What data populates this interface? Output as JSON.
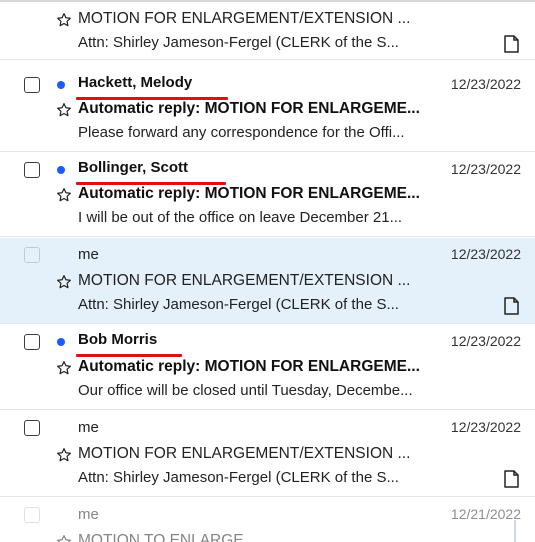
{
  "messages": [
    {
      "sender": "",
      "date": "",
      "unread": false,
      "subject": "MOTION FOR ENLARGEMENT/EXTENSION ...",
      "preview": "Attn: Shirley Jameson-Fergel (CLERK of the S...",
      "attachment": true
    },
    {
      "sender": "Hackett, Melody",
      "date": "12/23/2022",
      "unread": true,
      "subject": "Automatic reply: MOTION FOR ENLARGEME...",
      "preview": "Please forward any correspondence for the Offi...",
      "attachment": false
    },
    {
      "sender": "Bollinger, Scott",
      "date": "12/23/2022",
      "unread": true,
      "subject": "Automatic reply: MOTION FOR ENLARGEME...",
      "preview": "I will be out of the office on leave December 21...",
      "attachment": false
    },
    {
      "sender": "me",
      "date": "12/23/2022",
      "unread": false,
      "selected": true,
      "subject": "MOTION FOR ENLARGEMENT/EXTENSION ...",
      "preview": "Attn: Shirley Jameson-Fergel (CLERK of the S...",
      "attachment": true
    },
    {
      "sender": "Bob Morris",
      "date": "12/23/2022",
      "unread": true,
      "subject": "Automatic reply: MOTION FOR ENLARGEME...",
      "preview": "Our office will be closed until Tuesday, Decembe...",
      "attachment": false
    },
    {
      "sender": "me",
      "date": "12/23/2022",
      "unread": false,
      "subject": "MOTION FOR ENLARGEMENT/EXTENSION ...",
      "preview": "Attn: Shirley Jameson-Fergel (CLERK of the S...",
      "attachment": true
    },
    {
      "sender": "me",
      "date": "12/21/2022",
      "unread": false,
      "subject": "MOTION TO ENLARGE",
      "preview": "",
      "attachment": false
    }
  ],
  "colors": {
    "unread_dot": "#1a5cff",
    "selected_row": "#e4f0fa",
    "annotation_underline": "#e01010"
  },
  "icons": {
    "star": "star-outline-icon",
    "attachment": "document-icon",
    "checkbox": "checkbox-icon",
    "unread": "unread-dot-icon"
  }
}
